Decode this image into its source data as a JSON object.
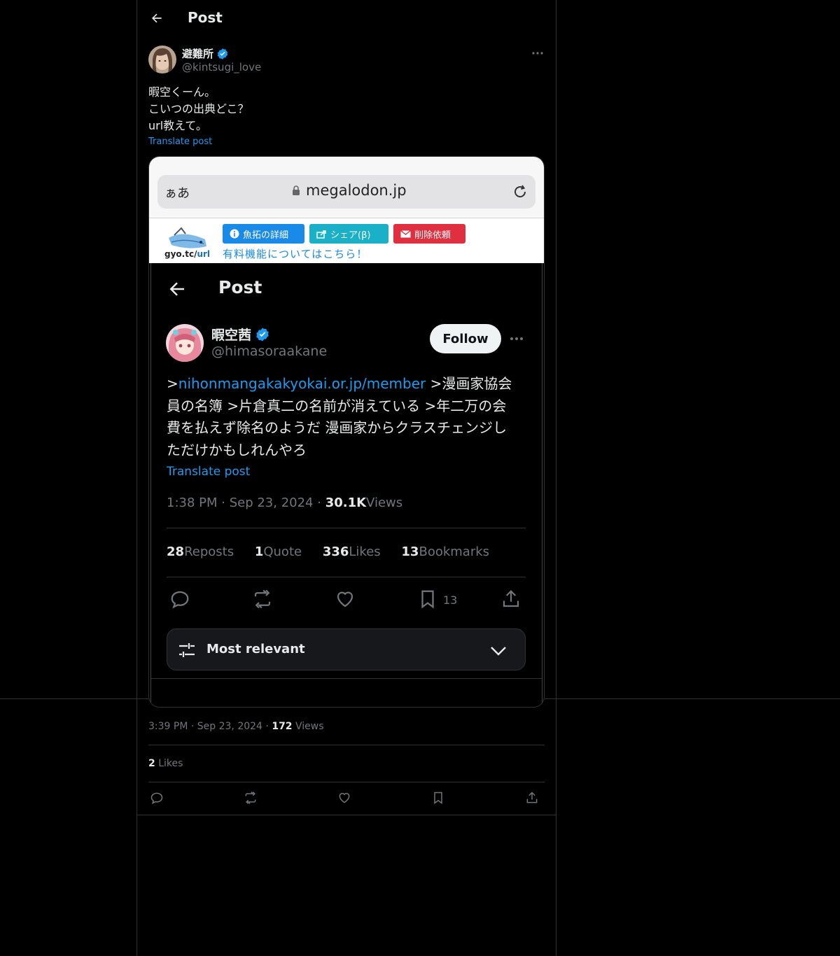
{
  "header": {
    "title": "Post"
  },
  "post": {
    "author_name": "避難所",
    "author_handle": "@kintsugi_love",
    "text_lines": [
      "暇空くーん。",
      "こいつの出典どこ？",
      "url教えて。"
    ],
    "translate_label": "Translate post",
    "time": "3:39 PM",
    "date": "Sep 23, 2024",
    "views_count": "172",
    "views_label": "Views",
    "likes_count": "2",
    "likes_label": "Likes",
    "verified": true
  },
  "screenshot": {
    "browser": {
      "aa": "ぁあ",
      "url": "megalodon.jp"
    },
    "gyotaku": {
      "logo_text": "gyo.tc/",
      "logo_text_accent": "url",
      "btn_detail": "魚拓の詳細",
      "btn_share": "シェア(β)",
      "btn_delete": "削除依頼",
      "paid_note": "有料機能についてはこちら！"
    },
    "x_post": {
      "header_title": "Post",
      "author_name": "暇空茜",
      "author_handle": "@himasoraakane",
      "follow_label": "Follow",
      "body_prefix": ">",
      "body_link": "nihonmangakakyokai.or.jp/member",
      "body_line1_rest": " >漫画家協会",
      "body_line2": "員の名簿 >片倉真二の名前が消えている >年二万の会",
      "body_line3": "費を払えず除名のようだ 漫画家からクラスチェンジし",
      "body_line4": "ただけかもしれんやろ",
      "translate_label": "Translate post",
      "time": "1:38 PM",
      "date": "Sep 23, 2024",
      "views_count": "30.1K",
      "views_label": "Views",
      "reposts_count": "28",
      "reposts_label": "Reposts",
      "quote_count": "1",
      "quote_label": "Quote",
      "likes_count": "336",
      "likes_label": "Likes",
      "bookmarks_count": "13",
      "bookmarks_label": "Bookmarks",
      "bookmark_action_count": "13",
      "sort_label": "Most relevant"
    }
  },
  "colors": {
    "accent": "#1d9bf0",
    "muted": "#71767b",
    "text": "#e7e9ea",
    "border": "#2f3336"
  }
}
